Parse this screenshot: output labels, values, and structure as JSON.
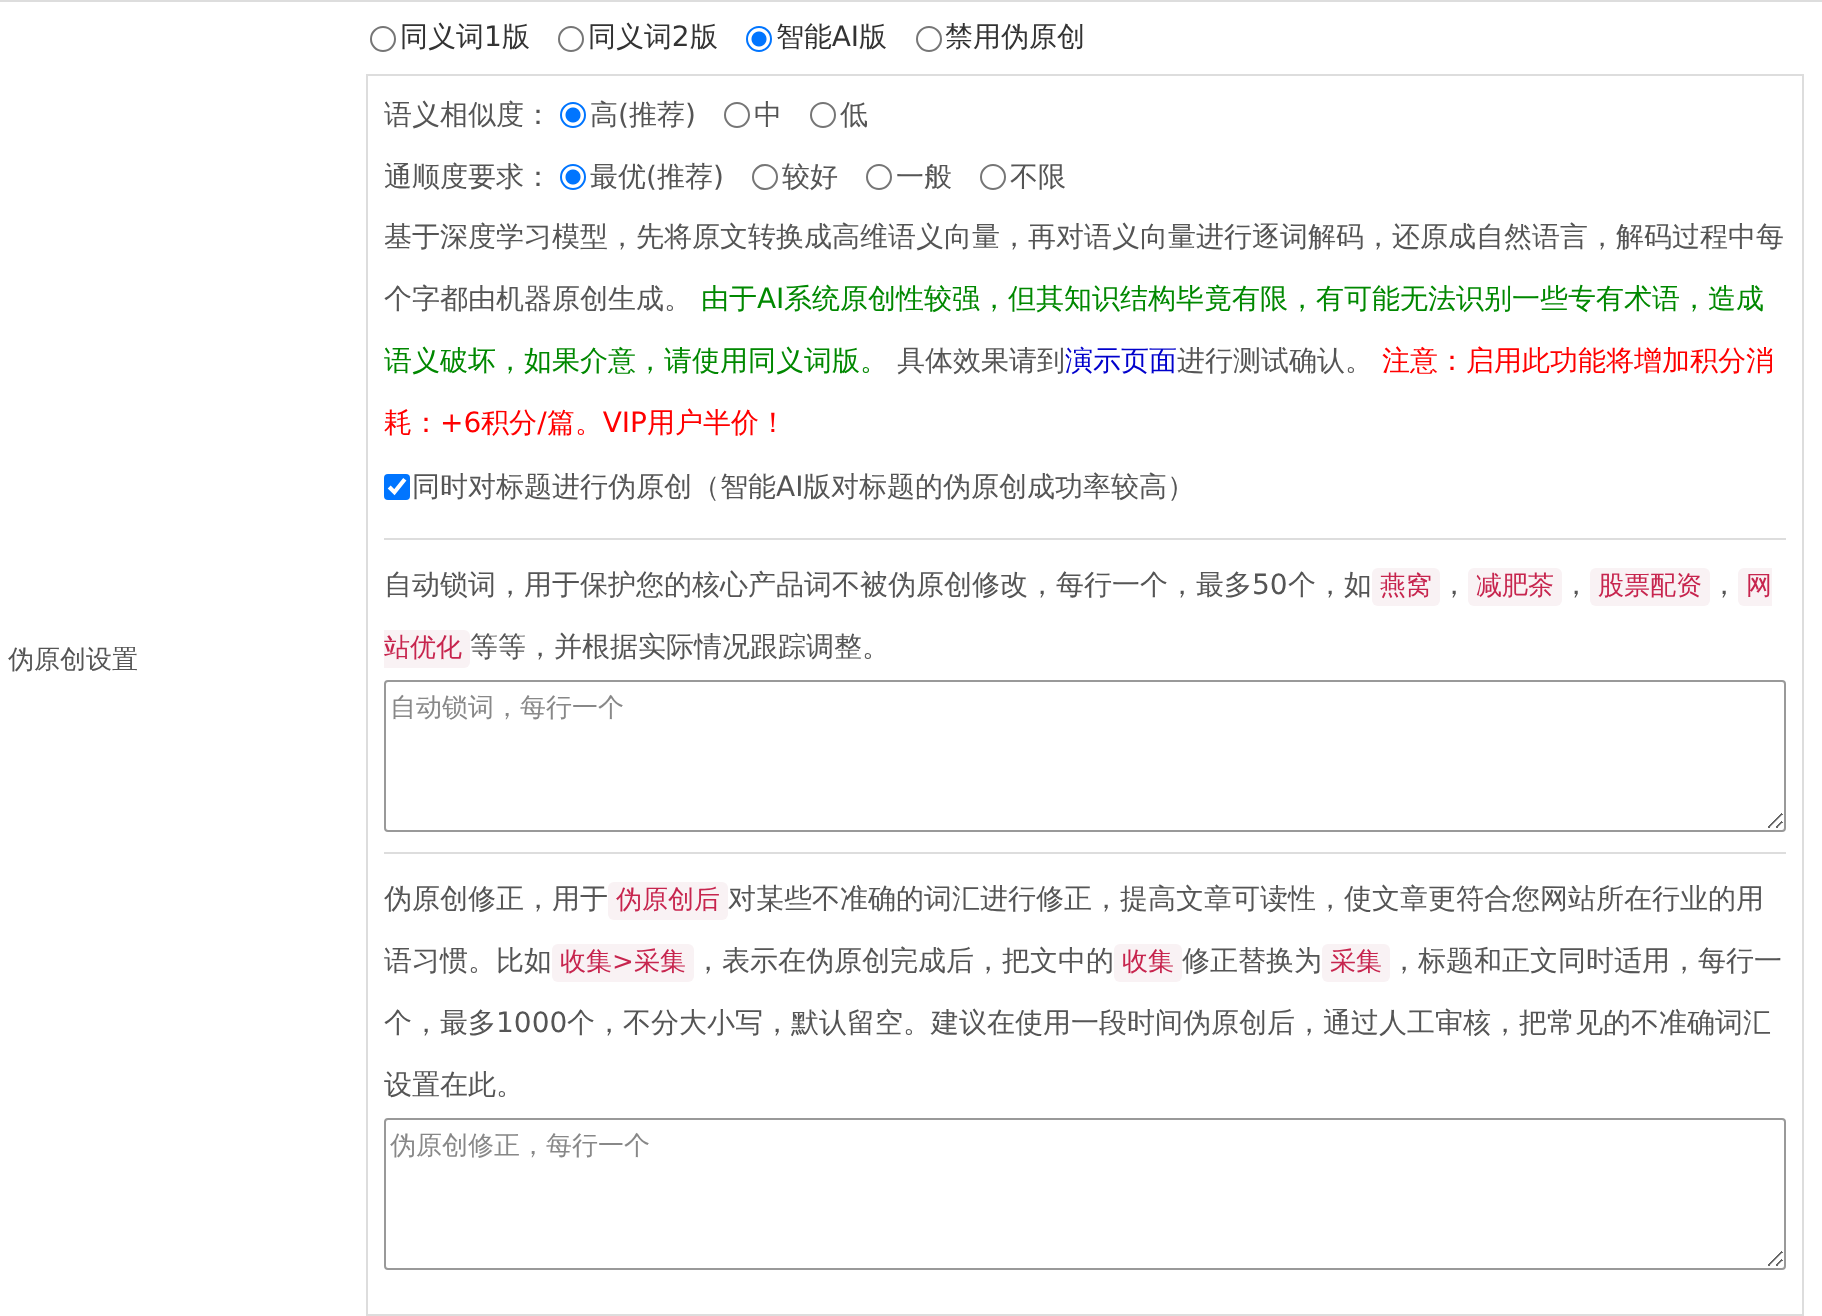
{
  "section_label": "伪原创设置",
  "mode_options": [
    {
      "label": "同义词1版",
      "selected": false
    },
    {
      "label": "同义词2版",
      "selected": false
    },
    {
      "label": "智能AI版",
      "selected": true
    },
    {
      "label": "禁用伪原创",
      "selected": false
    }
  ],
  "settings": [
    {
      "label": "语义相似度：",
      "options": [
        {
          "label": "高(推荐)",
          "selected": true
        },
        {
          "label": "中",
          "selected": false
        },
        {
          "label": "低",
          "selected": false
        }
      ]
    },
    {
      "label": "通顺度要求：",
      "options": [
        {
          "label": "最优(推荐)",
          "selected": true
        },
        {
          "label": "较好",
          "selected": false
        },
        {
          "label": "一般",
          "selected": false
        },
        {
          "label": "不限",
          "selected": false
        }
      ]
    }
  ],
  "description": [
    {
      "kind": "text",
      "text": "基于深度学习模型，先将原文转换成高维语义向量，再对语义向量进行逐词解码，还原成自然语言，解码过程中每个字都由机器原创生成。 "
    },
    {
      "kind": "green",
      "text": "由于AI系统原创性较强，但其知识结构毕竟有限，有可能无法识别一些专有术语，造成语义破坏，如果介意，请使用同义词版。"
    },
    {
      "kind": "text",
      "text": " 具体效果请到"
    },
    {
      "kind": "link",
      "text": "演示页面"
    },
    {
      "kind": "text",
      "text": "进行测试确认。 "
    },
    {
      "kind": "red",
      "text": "注意：启用此功能将增加积分消耗：+6积分/篇。VIP用户半价！"
    }
  ],
  "title_option": {
    "label": "同时对标题进行伪原创（智能AI版对标题的伪原创成功率较高）",
    "checked": true
  },
  "lock_words": {
    "segments": [
      {
        "kind": "text",
        "text": "自动锁词，用于保护您的核心产品词不被伪原创修改，每行一个，最多50个，如"
      },
      {
        "kind": "code",
        "text": "燕窝"
      },
      {
        "kind": "text",
        "text": "，"
      },
      {
        "kind": "code",
        "text": "减肥茶"
      },
      {
        "kind": "text",
        "text": "，"
      },
      {
        "kind": "code",
        "text": "股票配资"
      },
      {
        "kind": "text",
        "text": "，"
      },
      {
        "kind": "code",
        "text": "网站优化"
      },
      {
        "kind": "text",
        "text": "等等，并根据实际情况跟踪调整。"
      }
    ],
    "placeholder": "自动锁词，每行一个"
  },
  "correction": {
    "segments": [
      {
        "kind": "text",
        "text": "伪原创修正，用于"
      },
      {
        "kind": "code",
        "text": "伪原创后"
      },
      {
        "kind": "text",
        "text": "对某些不准确的词汇进行修正，提高文章可读性，使文章更符合您网站所在行业的用语习惯。比如"
      },
      {
        "kind": "code",
        "text": "收集>采集"
      },
      {
        "kind": "text",
        "text": "，表示在伪原创完成后，把文中的"
      },
      {
        "kind": "code",
        "text": "收集"
      },
      {
        "kind": "text",
        "text": "修正替换为"
      },
      {
        "kind": "code",
        "text": "采集"
      },
      {
        "kind": "text",
        "text": "，标题和正文同时适用，每行一个，最多1000个，不分大小写，默认留空。建议在使用一段时间伪原创后，通过人工审核，把常见的不准确词汇设置在此。"
      }
    ],
    "placeholder": "伪原创修正，每行一个"
  }
}
